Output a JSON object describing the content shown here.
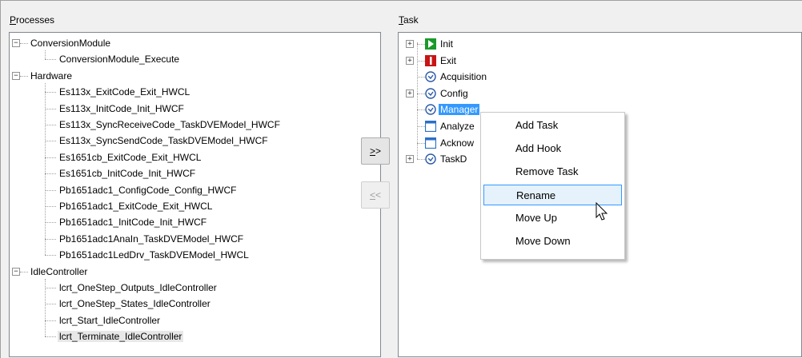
{
  "processes": {
    "label_acc": "P",
    "label_rest": "rocesses",
    "tree": [
      {
        "text": "ConversionModule",
        "expander": "−"
      },
      {
        "text": "ConversionModule_Execute"
      },
      {
        "text": "Hardware",
        "expander": "−"
      },
      {
        "text": "Es113x_ExitCode_Exit_HWCL"
      },
      {
        "text": "Es113x_InitCode_Init_HWCF"
      },
      {
        "text": "Es113x_SyncReceiveCode_TaskDVEModel_HWCF"
      },
      {
        "text": "Es113x_SyncSendCode_TaskDVEModel_HWCF"
      },
      {
        "text": "Es1651cb_ExitCode_Exit_HWCL"
      },
      {
        "text": "Es1651cb_InitCode_Init_HWCF"
      },
      {
        "text": "Pb1651adc1_ConfigCode_Config_HWCF"
      },
      {
        "text": "Pb1651adc1_ExitCode_Exit_HWCL"
      },
      {
        "text": "Pb1651adc1_InitCode_Init_HWCF"
      },
      {
        "text": "Pb1651adc1AnaIn_TaskDVEModel_HWCF"
      },
      {
        "text": "Pb1651adc1LedDrv_TaskDVEModel_HWCL"
      },
      {
        "text": "IdleController",
        "expander": "−"
      },
      {
        "text": "lcrt_OneStep_Outputs_IdleController"
      },
      {
        "text": "lcrt_OneStep_States_IdleController"
      },
      {
        "text": "lcrt_Start_IdleController"
      },
      {
        "text": "lcrt_Terminate_IdleController"
      }
    ]
  },
  "buttons": {
    "assign_acc": ">",
    "assign_rest": ">",
    "remove_acc": "<",
    "remove_rest": "<"
  },
  "task": {
    "label_acc": "T",
    "label_rest": "ask",
    "tree": [
      {
        "text": "Init",
        "expander": "+",
        "icon": "init-task-icon"
      },
      {
        "text": "Exit",
        "expander": "+",
        "icon": "exit-task-icon"
      },
      {
        "text": "Acquisition",
        "icon": "timer-task-icon"
      },
      {
        "text": "Config",
        "expander": "+",
        "icon": "timer-task-icon"
      },
      {
        "text": "Manager",
        "icon": "timer-task-icon"
      },
      {
        "text": "Analyze",
        "icon": "software-task-icon"
      },
      {
        "text": "Acknow",
        "icon": "software-task-icon"
      },
      {
        "text": "TaskD",
        "expander": "+",
        "icon": "timer-task-icon"
      }
    ]
  },
  "context_menu": {
    "items": [
      "Add Task",
      "Add Hook",
      "Remove Task",
      "Rename",
      "Move Up",
      "Move Down"
    ],
    "highlighted": "Rename"
  }
}
